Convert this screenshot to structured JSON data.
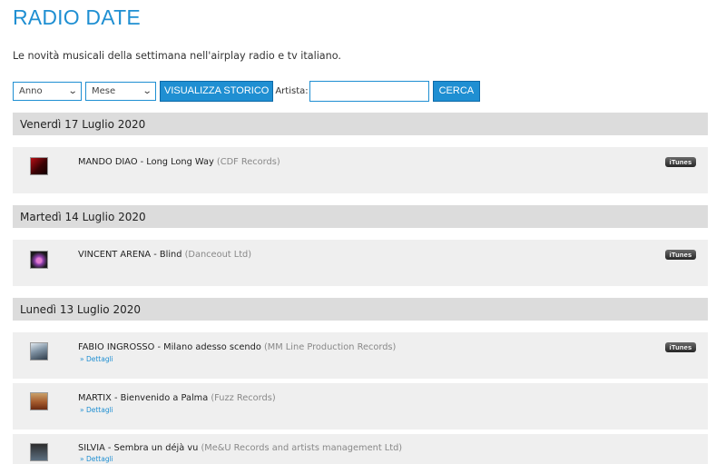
{
  "page": {
    "title": "RADIO DATE",
    "subtitle": "Le novità musicali della settimana nell'airplay radio e tv italiano."
  },
  "filters": {
    "year_select": "Anno",
    "month_select": "Mese",
    "history_button": "VISUALIZZA STORICO",
    "artist_label": "Artista:",
    "artist_value": "",
    "search_button": "CERCA"
  },
  "days": [
    {
      "date": "Venerdì 17 Luglio 2020",
      "releases": [
        {
          "artist_title": "MANDO DIAO - Long Long Way",
          "label": "(CDF Records)",
          "itunes": "iTunes",
          "details": ""
        }
      ]
    },
    {
      "date": "Martedì 14 Luglio 2020",
      "releases": [
        {
          "artist_title": "VINCENT ARENA - Blind",
          "label": "(Danceout Ltd)",
          "itunes": "iTunes",
          "details": ""
        }
      ]
    },
    {
      "date": "Lunedì 13 Luglio 2020",
      "releases": [
        {
          "artist_title": "FABIO INGROSSO - Milano adesso scendo",
          "label": "(MM Line Production Records)",
          "itunes": "iTunes",
          "details": "» Dettagli"
        },
        {
          "artist_title": "MARTIX - Bienvenido a Palma",
          "label": "(Fuzz Records)",
          "itunes": "",
          "details": "» Dettagli"
        },
        {
          "artist_title": "SILVIA - Sembra un déjà vu",
          "label": "(Me&U Records and artists management Ltd)",
          "itunes": "",
          "details": "» Dettagli"
        }
      ]
    }
  ],
  "colors": {
    "accent": "#1f8fd2",
    "date_bar": "#dcdcdc",
    "row_bg": "#efefef"
  }
}
